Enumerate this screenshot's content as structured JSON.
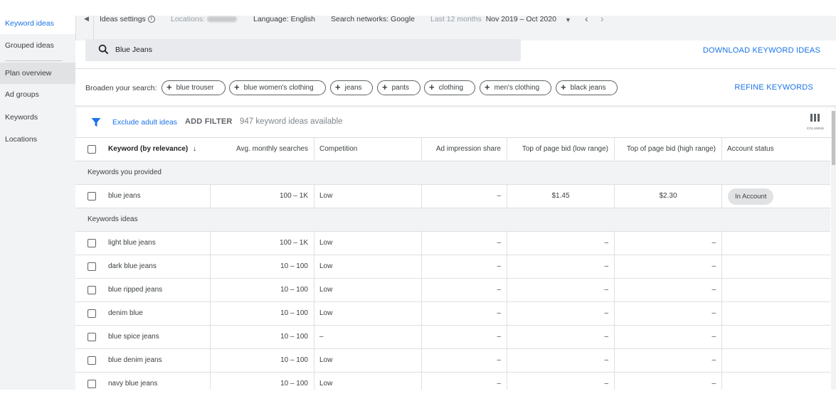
{
  "sidebar": {
    "items": [
      {
        "label": "Keyword ideas",
        "state": "active"
      },
      {
        "label": "Grouped ideas",
        "state": "normal"
      },
      {
        "label": "Plan overview",
        "state": "shaded"
      },
      {
        "label": "Ad groups",
        "state": "normal"
      },
      {
        "label": "Keywords",
        "state": "normal"
      },
      {
        "label": "Locations",
        "state": "normal"
      }
    ]
  },
  "settings": {
    "ideas_settings": "Ideas settings",
    "locations_label": "Locations:",
    "language_label": "Language:",
    "language_value": "English",
    "networks_label": "Search networks:",
    "networks_value": "Google",
    "period_label": "Last 12 months",
    "period_value": "Nov 2019 – Oct 2020"
  },
  "search": {
    "value": "Blue Jeans",
    "download_label": "DOWNLOAD KEYWORD IDEAS"
  },
  "broaden": {
    "label": "Broaden your search:",
    "chips": [
      "blue trouser",
      "blue women's clothing",
      "jeans",
      "pants",
      "clothing",
      "men's clothing",
      "black jeans"
    ],
    "refine_label": "REFINE KEYWORDS"
  },
  "filters": {
    "exclude_label": "Exclude adult ideas",
    "add_filter_label": "ADD FILTER",
    "count_text": "947 keyword ideas available",
    "columns_label": "COLUMNS"
  },
  "table": {
    "headers": {
      "keyword": "Keyword (by relevance)",
      "searches": "Avg. monthly searches",
      "competition": "Competition",
      "impression": "Ad impression share",
      "bid_low": "Top of page bid (low range)",
      "bid_high": "Top of page bid (high range)",
      "status": "Account status"
    },
    "group_provided": "Keywords you provided",
    "group_ideas": "Keywords ideas",
    "provided": [
      {
        "keyword": "blue jeans",
        "searches": "100 – 1K",
        "competition": "Low",
        "impression": "–",
        "bid_low": "$1.45",
        "bid_high": "$2.30",
        "status": "In Account"
      }
    ],
    "ideas": [
      {
        "keyword": "light blue jeans",
        "searches": "100 – 1K",
        "competition": "Low",
        "impression": "–",
        "bid_low": "–",
        "bid_high": "–",
        "status": ""
      },
      {
        "keyword": "dark blue jeans",
        "searches": "10 – 100",
        "competition": "Low",
        "impression": "–",
        "bid_low": "–",
        "bid_high": "–",
        "status": ""
      },
      {
        "keyword": "blue ripped jeans",
        "searches": "10 – 100",
        "competition": "Low",
        "impression": "–",
        "bid_low": "–",
        "bid_high": "–",
        "status": ""
      },
      {
        "keyword": "denim blue",
        "searches": "10 – 100",
        "competition": "Low",
        "impression": "–",
        "bid_low": "–",
        "bid_high": "–",
        "status": ""
      },
      {
        "keyword": "blue spice jeans",
        "searches": "10 – 100",
        "competition": "–",
        "impression": "–",
        "bid_low": "–",
        "bid_high": "–",
        "status": ""
      },
      {
        "keyword": "blue denim jeans",
        "searches": "10 – 100",
        "competition": "Low",
        "impression": "–",
        "bid_low": "–",
        "bid_high": "–",
        "status": ""
      },
      {
        "keyword": "navy blue jeans",
        "searches": "10 – 100",
        "competition": "Low",
        "impression": "–",
        "bid_low": "–",
        "bid_high": "–",
        "status": ""
      }
    ]
  },
  "colors": {
    "accent": "#1a73e8",
    "sidebar_bg": "#f1f3f4",
    "group_bg": "#f1f3f4"
  }
}
